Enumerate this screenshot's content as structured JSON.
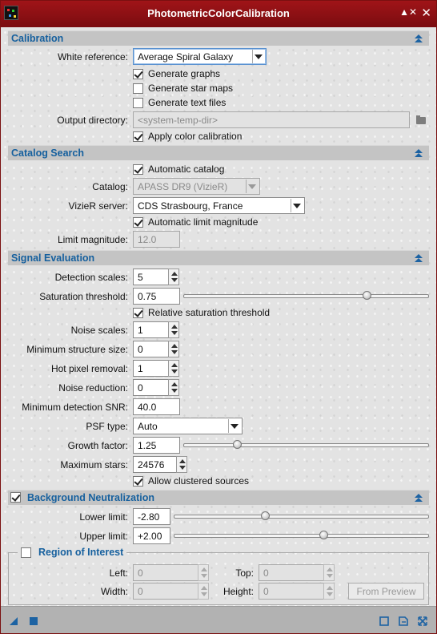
{
  "window": {
    "title": "PhotometricColorCalibration"
  },
  "calibration": {
    "header": "Calibration",
    "white_reference_label": "White reference:",
    "white_reference_value": "Average Spiral Galaxy",
    "generate_graphs": "Generate graphs",
    "generate_graphs_checked": true,
    "generate_star_maps": "Generate star maps",
    "generate_star_maps_checked": false,
    "generate_text_files": "Generate text files",
    "generate_text_files_checked": false,
    "output_directory_label": "Output directory:",
    "output_directory_placeholder": "<system-temp-dir>",
    "apply_color_calibration": "Apply color calibration",
    "apply_color_calibration_checked": true
  },
  "catalog_search": {
    "header": "Catalog Search",
    "automatic_catalog": "Automatic catalog",
    "automatic_catalog_checked": true,
    "catalog_label": "Catalog:",
    "catalog_value": "APASS DR9 (VizieR)",
    "vizier_server_label": "VizieR server:",
    "vizier_server_value": "CDS Strasbourg, France",
    "automatic_limit_magnitude": "Automatic limit magnitude",
    "automatic_limit_magnitude_checked": true,
    "limit_magnitude_label": "Limit magnitude:",
    "limit_magnitude_value": "12.0"
  },
  "signal_evaluation": {
    "header": "Signal Evaluation",
    "detection_scales_label": "Detection scales:",
    "detection_scales_value": "5",
    "saturation_threshold_label": "Saturation threshold:",
    "saturation_threshold_value": "0.75",
    "saturation_threshold_slider": 0.75,
    "relative_saturation_threshold": "Relative saturation threshold",
    "relative_saturation_threshold_checked": true,
    "noise_scales_label": "Noise scales:",
    "noise_scales_value": "1",
    "minimum_structure_size_label": "Minimum structure size:",
    "minimum_structure_size_value": "0",
    "hot_pixel_removal_label": "Hot pixel removal:",
    "hot_pixel_removal_value": "1",
    "noise_reduction_label": "Noise reduction:",
    "noise_reduction_value": "0",
    "minimum_detection_snr_label": "Minimum detection SNR:",
    "minimum_detection_snr_value": "40.0",
    "psf_type_label": "PSF type:",
    "psf_type_value": "Auto",
    "growth_factor_label": "Growth factor:",
    "growth_factor_value": "1.25",
    "growth_factor_slider": 0.22,
    "maximum_stars_label": "Maximum stars:",
    "maximum_stars_value": "24576",
    "allow_clustered_sources": "Allow clustered sources",
    "allow_clustered_sources_checked": true
  },
  "background_neutralization": {
    "header": "Background Neutralization",
    "enabled": true,
    "lower_limit_label": "Lower limit:",
    "lower_limit_value": "-2.80",
    "lower_limit_slider": 0.36,
    "upper_limit_label": "Upper limit:",
    "upper_limit_value": "+2.00",
    "upper_limit_slider": 0.59
  },
  "region_of_interest": {
    "header": "Region of Interest",
    "enabled": false,
    "left_label": "Left:",
    "left_value": "0",
    "top_label": "Top:",
    "top_value": "0",
    "width_label": "Width:",
    "width_value": "0",
    "height_label": "Height:",
    "height_value": "0",
    "from_preview_button": "From Preview"
  },
  "colors": {
    "title_bar": "#8e1014",
    "section_title": "#16609e",
    "accent_icon": "#1d63a3"
  },
  "icons": [
    "app-icon",
    "shade-icon",
    "close-icon",
    "collapse-icon",
    "folder-icon",
    "new-instance-icon",
    "apply-global-icon",
    "preview-icon",
    "reset-icon",
    "resize-icon"
  ]
}
